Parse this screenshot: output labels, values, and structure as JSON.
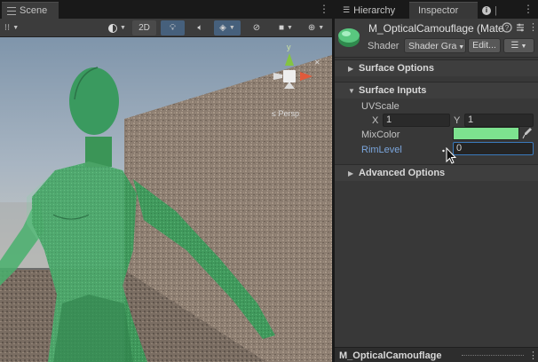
{
  "scene": {
    "tab_label": "Scene",
    "toolbar": {
      "mode_2d_label": "2D"
    },
    "gizmo": {
      "axis_y_label": "y",
      "projection_label": "Persp"
    }
  },
  "inspector": {
    "tabs": [
      {
        "label": "Hierarchy",
        "icon": "list-icon"
      },
      {
        "label": "Inspector",
        "icon": "info-icon"
      }
    ],
    "material": {
      "name": "M_OpticalCamouflage (Mate",
      "shader_label": "Shader",
      "shader_value": "Shader Gra",
      "edit_label": "Edit...",
      "list_label": "☰"
    },
    "sections": {
      "surface_options": "Surface Options",
      "surface_inputs": "Surface Inputs",
      "advanced_options": "Advanced Options"
    },
    "properties": {
      "uvscale_label": "UVScale",
      "x_label": "X",
      "x_value": "1",
      "y_label": "Y",
      "y_value": "1",
      "mixcolor_label": "MixColor",
      "mixcolor_color": "#7de28f",
      "rimlevel_label": "RimLevel",
      "rimlevel_value": "0"
    },
    "bottom_bar": {
      "name": "M_OpticalCamouflage"
    }
  },
  "colors": {
    "accent_blue": "#46607c",
    "link_blue": "#7ba6dd",
    "figure_green": "#3fa261",
    "wall": "#8e7f72"
  }
}
